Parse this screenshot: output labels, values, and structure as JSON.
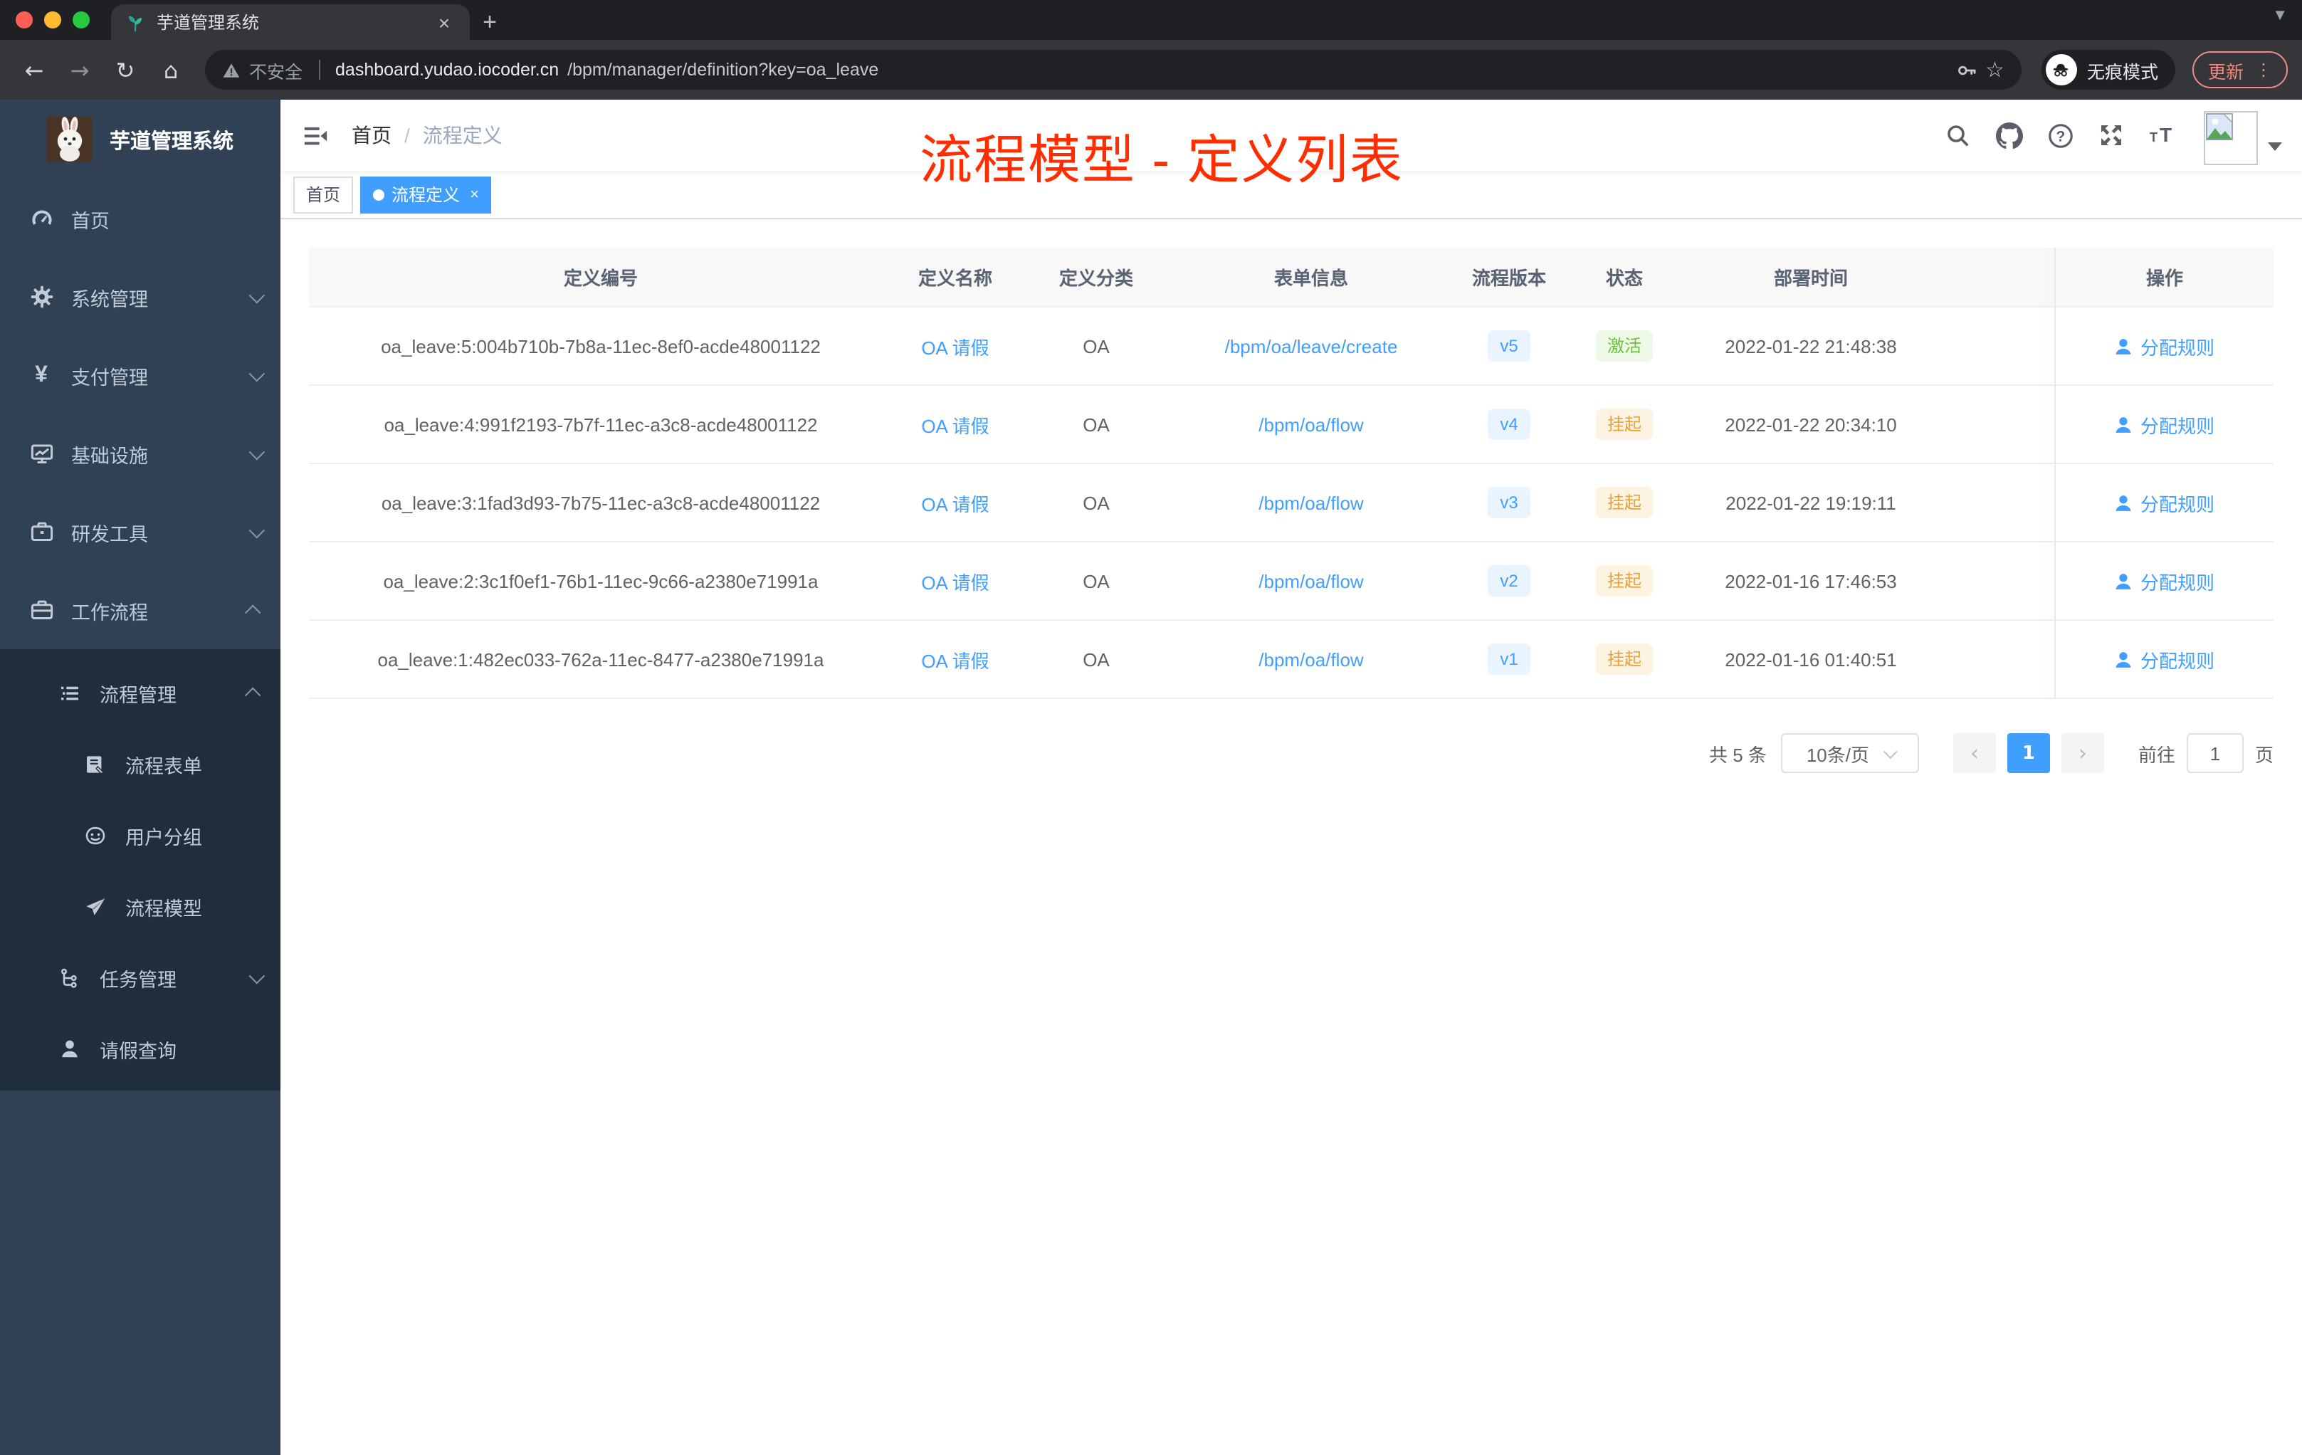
{
  "colors": {
    "accent": "#409eff",
    "annotation": "#ff2d00",
    "sidebar_bg": "#304156",
    "submenu_bg": "#1f2d3d",
    "status_active": "#67c23a",
    "status_suspend": "#e6a23c"
  },
  "browser": {
    "tab_title": "芋道管理系统",
    "close_label": "×",
    "new_tab_label": "+",
    "back": "←",
    "forward": "→",
    "reload": "↻",
    "home": "⌂",
    "security_label": "不安全",
    "url_host": "dashboard.yudao.iocoder.cn",
    "url_path": "/bpm/manager/definition?key=oa_leave",
    "star": "☆",
    "incognito_label": "无痕模式",
    "update_label": "更新",
    "menu_dots": "⋮"
  },
  "sidebar": {
    "logo_title": "芋道管理系统",
    "items": [
      {
        "label": "首页",
        "icon": "dashboard-icon"
      },
      {
        "label": "系统管理",
        "icon": "gear-icon"
      },
      {
        "label": "支付管理",
        "icon": "yen-icon"
      },
      {
        "label": "基础设施",
        "icon": "monitor-icon"
      },
      {
        "label": "研发工具",
        "icon": "toolbox-icon"
      },
      {
        "label": "工作流程",
        "icon": "briefcase-icon"
      }
    ],
    "submenu": [
      {
        "label": "流程管理",
        "icon": "list-icon"
      },
      {
        "label": "流程表单",
        "icon": "form-icon"
      },
      {
        "label": "用户分组",
        "icon": "group-icon"
      },
      {
        "label": "流程模型",
        "icon": "paper-plane-icon"
      },
      {
        "label": "任务管理",
        "icon": "tree-icon"
      },
      {
        "label": "请假查询",
        "icon": "person-icon"
      }
    ]
  },
  "navbar": {
    "breadcrumb": [
      "首页",
      "流程定义"
    ],
    "separator": "/"
  },
  "tags": [
    {
      "label": "首页"
    },
    {
      "label": "流程定义",
      "close": "×"
    }
  ],
  "annotation": {
    "text": "流程模型 - 定义列表"
  },
  "table": {
    "columns": [
      "定义编号",
      "定义名称",
      "定义分类",
      "表单信息",
      "流程版本",
      "状态",
      "部署时间",
      "操作"
    ],
    "rows": [
      {
        "id": "oa_leave:5:004b710b-7b8a-11ec-8ef0-acde48001122",
        "name": "OA 请假",
        "category": "OA",
        "form": "/bpm/oa/leave/create",
        "version": "v5",
        "status": "激活",
        "status_type": "success",
        "time": "2022-01-22 21:48:38",
        "action": "分配规则"
      },
      {
        "id": "oa_leave:4:991f2193-7b7f-11ec-a3c8-acde48001122",
        "name": "OA 请假",
        "category": "OA",
        "form": "/bpm/oa/flow",
        "version": "v4",
        "status": "挂起",
        "status_type": "warning",
        "time": "2022-01-22 20:34:10",
        "action": "分配规则"
      },
      {
        "id": "oa_leave:3:1fad3d93-7b75-11ec-a3c8-acde48001122",
        "name": "OA 请假",
        "category": "OA",
        "form": "/bpm/oa/flow",
        "version": "v3",
        "status": "挂起",
        "status_type": "warning",
        "time": "2022-01-22 19:19:11",
        "action": "分配规则"
      },
      {
        "id": "oa_leave:2:3c1f0ef1-76b1-11ec-9c66-a2380e71991a",
        "name": "OA 请假",
        "category": "OA",
        "form": "/bpm/oa/flow",
        "version": "v2",
        "status": "挂起",
        "status_type": "warning",
        "time": "2022-01-16 17:46:53",
        "action": "分配规则"
      },
      {
        "id": "oa_leave:1:482ec033-762a-11ec-8477-a2380e71991a",
        "name": "OA 请假",
        "category": "OA",
        "form": "/bpm/oa/flow",
        "version": "v1",
        "status": "挂起",
        "status_type": "warning",
        "time": "2022-01-16 01:40:51",
        "action": "分配规则"
      }
    ]
  },
  "pagination": {
    "total": "共 5 条",
    "page_size": "10条/页",
    "prev": "‹",
    "page": "1",
    "next": "›",
    "goto_label": "前往",
    "goto_value": "1",
    "unit": "页"
  }
}
